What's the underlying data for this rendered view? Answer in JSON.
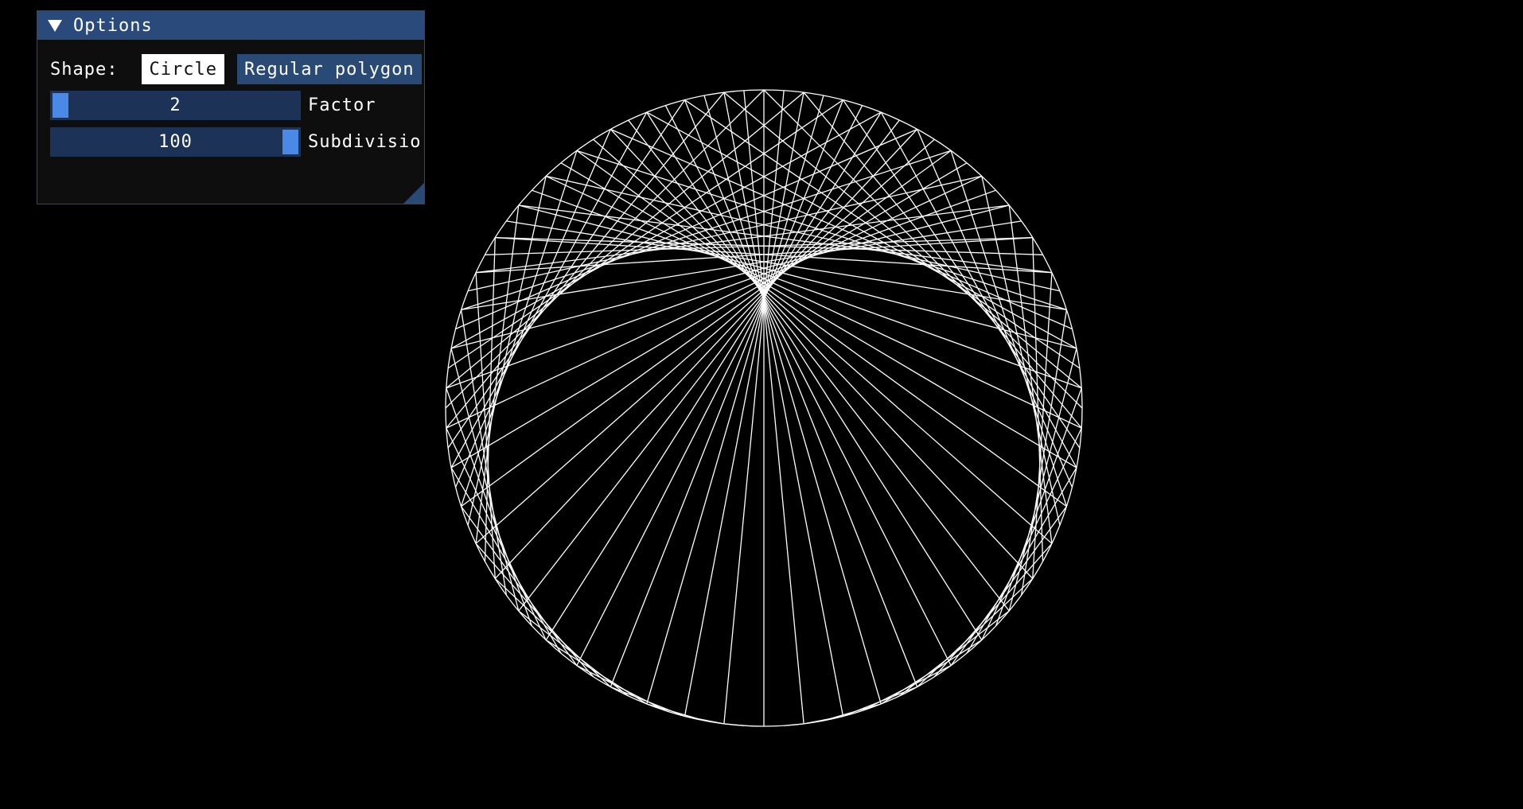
{
  "window": {
    "title": "Options",
    "collapse_icon": "triangle-down-icon"
  },
  "shape": {
    "label": "Shape:",
    "options": [
      "Circle",
      "Regular polygon"
    ],
    "selected": "Circle"
  },
  "factor": {
    "value": "2",
    "label": "Factor",
    "fraction": 0.0
  },
  "subdivisions": {
    "value": "100",
    "label": "Subdivisio",
    "fraction": 1.0
  },
  "colors": {
    "background": "#000000",
    "lines": "#ffffff",
    "title_bar": "#294a7a",
    "slider_bg": "#1c3256",
    "slider_grab": "#4a8ae6",
    "button": "#2a4a76"
  },
  "pattern": {
    "multiplier": 2,
    "points": 100
  }
}
